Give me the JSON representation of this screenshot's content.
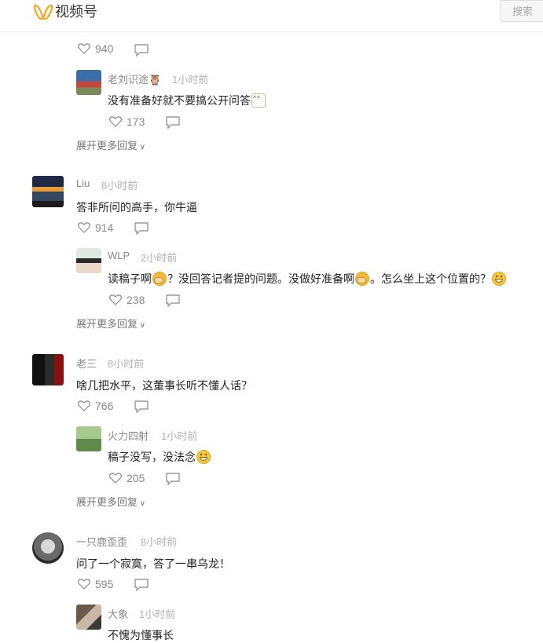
{
  "header": {
    "logo_text": "视频号",
    "search_label": "搜索"
  },
  "cut_comment": {
    "text": "...",
    "likes": "940"
  },
  "threads": [
    {
      "reply": {
        "name": "老刘识途🦉",
        "time": "1小时前",
        "text": "没有准备好就不要搞公开问答",
        "likes": "173"
      },
      "expand": "展开更多回复"
    },
    {
      "comment": {
        "name": "Liu",
        "time": "8小时前",
        "text": "答非所问的高手，你牛逼",
        "likes": "914"
      },
      "reply": {
        "name": "WLP",
        "time": "2小时前",
        "text_a": "读稿子啊",
        "text_b": "？没回答记者提的问题。没做好准备啊",
        "text_c": "。怎么坐上这个位置的？",
        "likes": "238"
      },
      "expand": "展开更多回复"
    },
    {
      "comment": {
        "name": "老三",
        "time": "8小时前",
        "text": "啥几把水平，这董事长听不懂人话？",
        "likes": "766"
      },
      "reply": {
        "name": "火力四射",
        "time": "1小时前",
        "text": "稿子没写，没法念",
        "likes": "205"
      },
      "expand": "展开更多回复"
    },
    {
      "comment": {
        "name": "一只鹿歪歪",
        "time": "8小时前",
        "text": "问了一个寂寞，答了一串乌龙！",
        "likes": "595"
      },
      "reply": {
        "name": "大象",
        "time": "1小时前",
        "text": "不愧为懂事长"
      }
    }
  ],
  "colors": {
    "logo": "#f5a623",
    "text": "#222222",
    "muted": "#888888",
    "time": "#b0b0b0"
  }
}
